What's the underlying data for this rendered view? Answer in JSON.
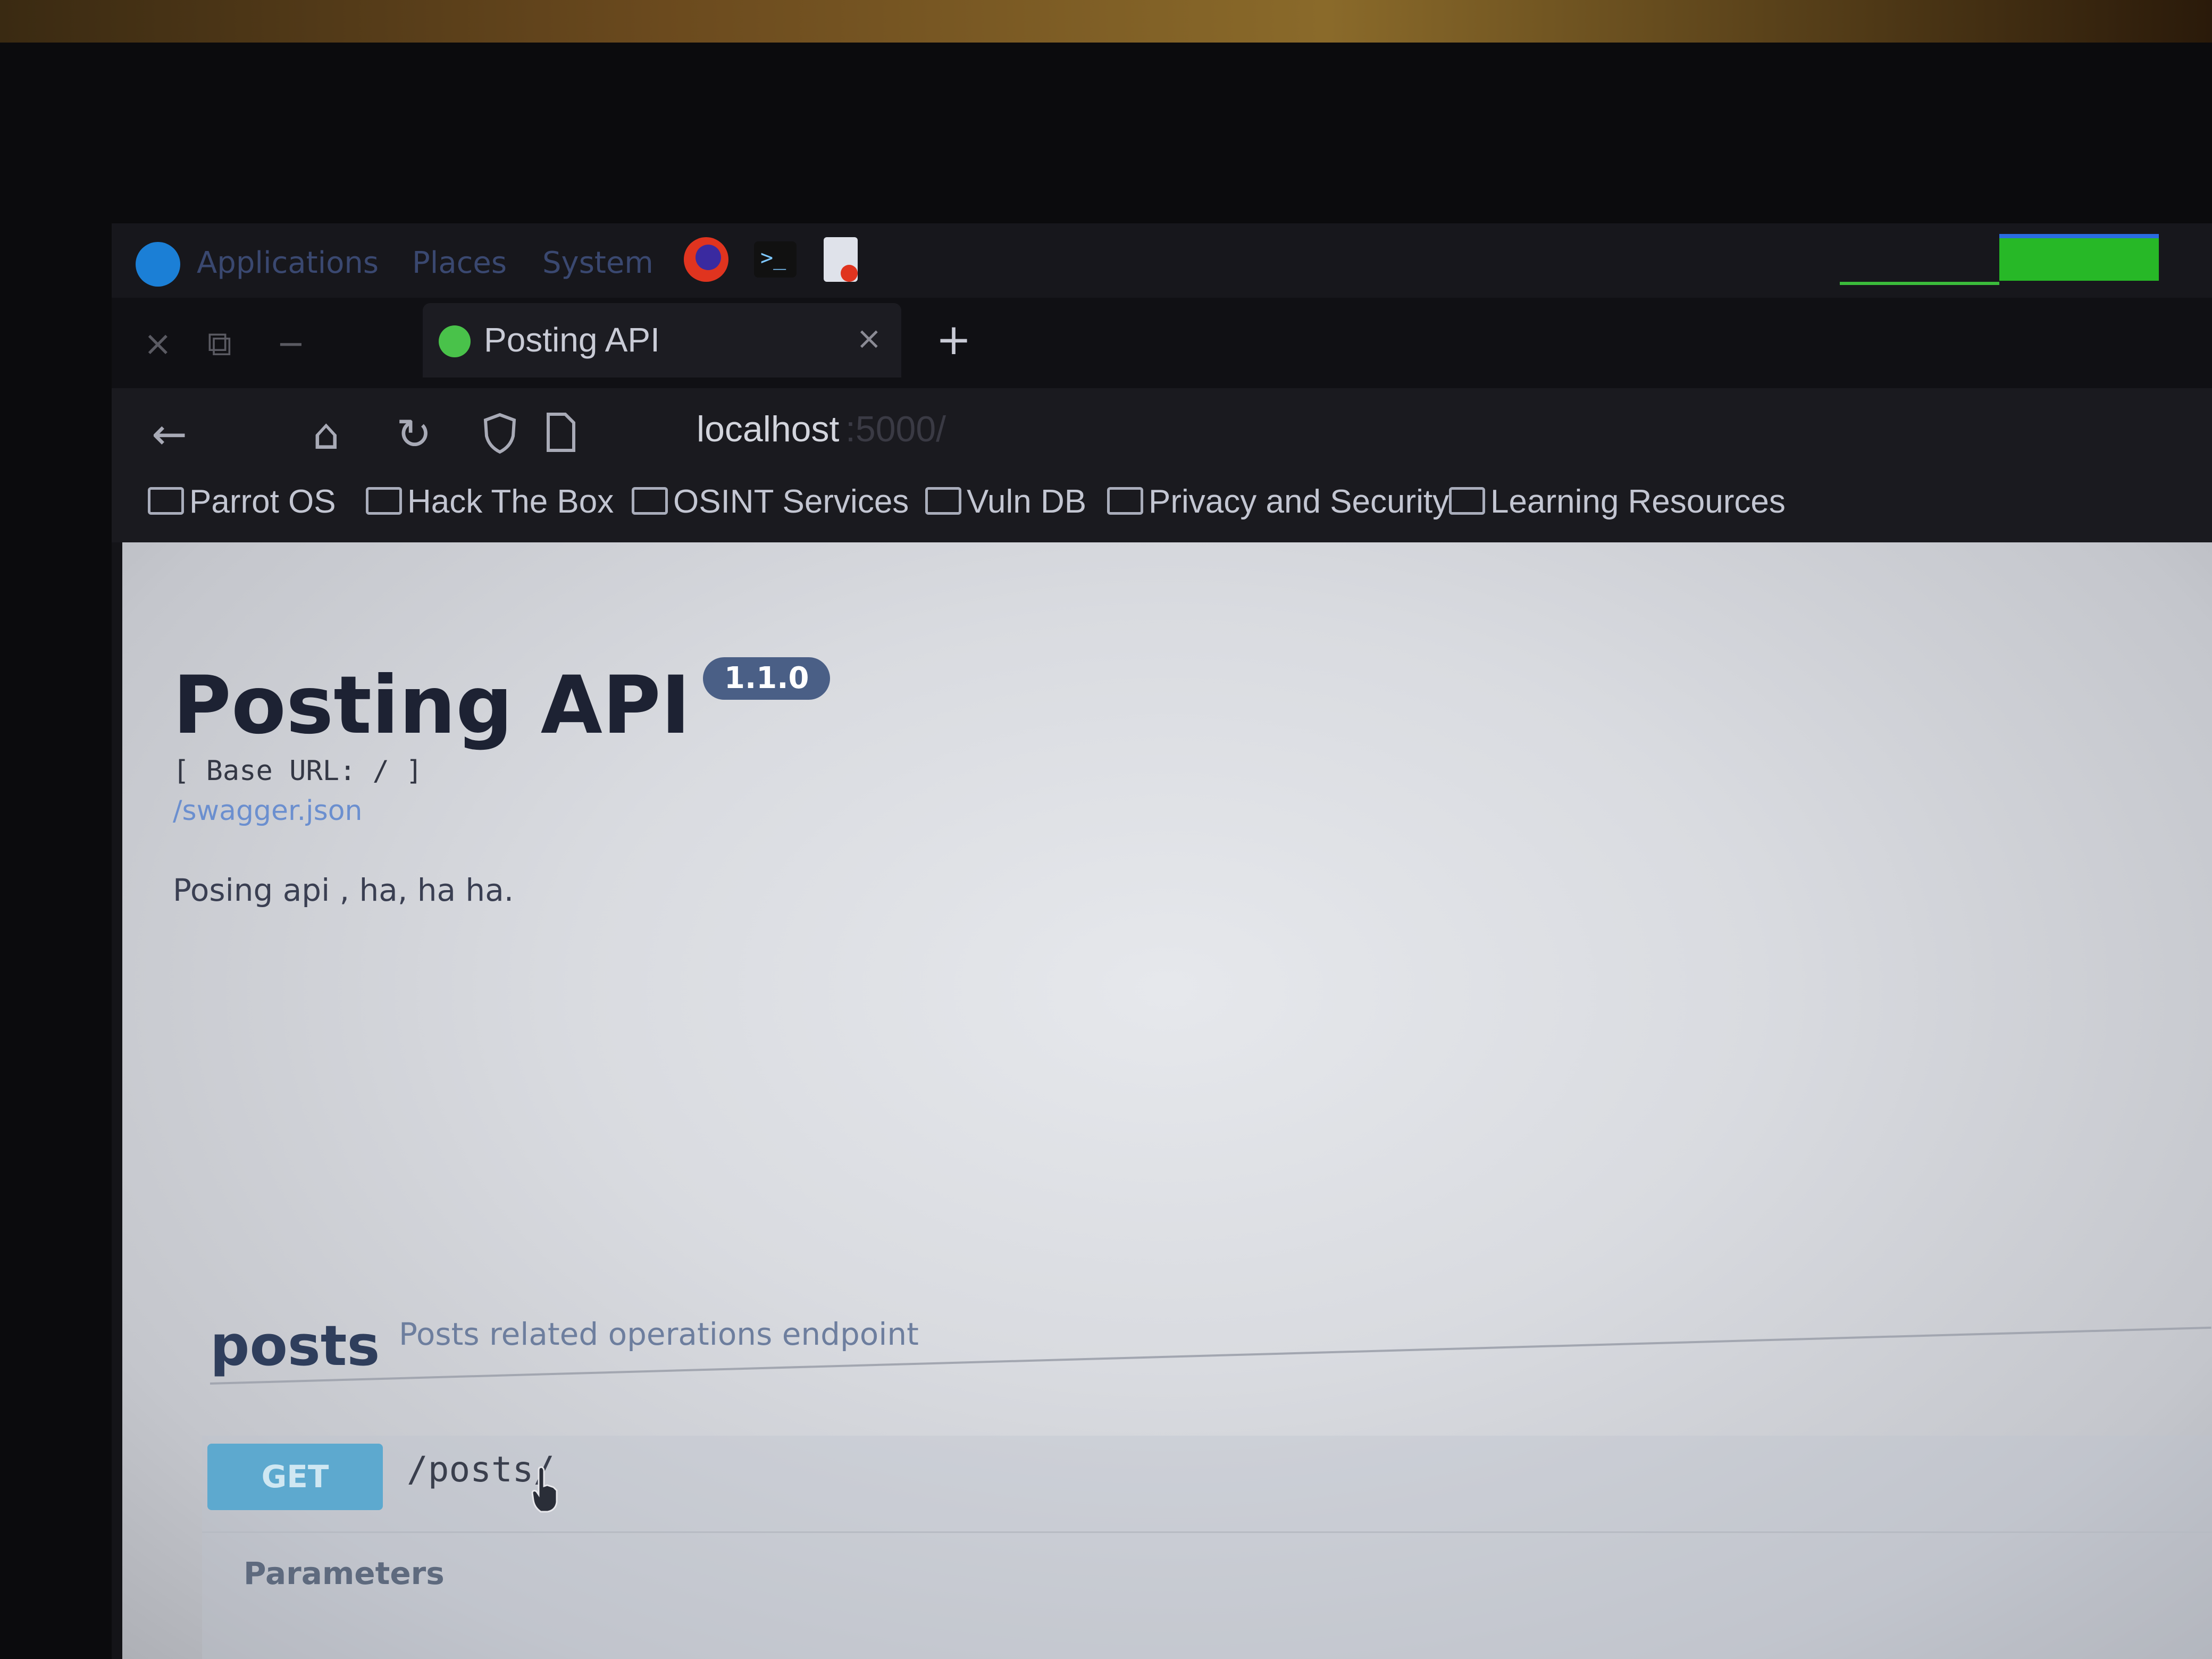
{
  "os_panel": {
    "menu": [
      "Applications",
      "Places",
      "System"
    ]
  },
  "browser": {
    "tab": {
      "title": "Posting API",
      "close": "×"
    },
    "new_tab": "+",
    "window_controls": {
      "close": "×",
      "maximize": "⧉",
      "minimize": "−"
    },
    "nav": {
      "back": "←",
      "home": "⌂",
      "reload": "↻",
      "url_host": "localhost",
      "url_rest": ":5000/"
    },
    "bookmarks": [
      "Parrot OS",
      "Hack The Box",
      "OSINT Services",
      "Vuln DB",
      "Privacy and Security",
      "Learning Resources"
    ]
  },
  "page": {
    "title": "Posting API",
    "version": "1.1.0",
    "base_url": "[ Base URL: / ]",
    "swagger_link": "/swagger.json",
    "description": "Posing api , ha, ha ha.",
    "tag": {
      "name": "posts",
      "description": "Posts related operations endpoint"
    },
    "operation": {
      "method": "GET",
      "path": "/posts/"
    },
    "parameters_label": "Parameters"
  }
}
